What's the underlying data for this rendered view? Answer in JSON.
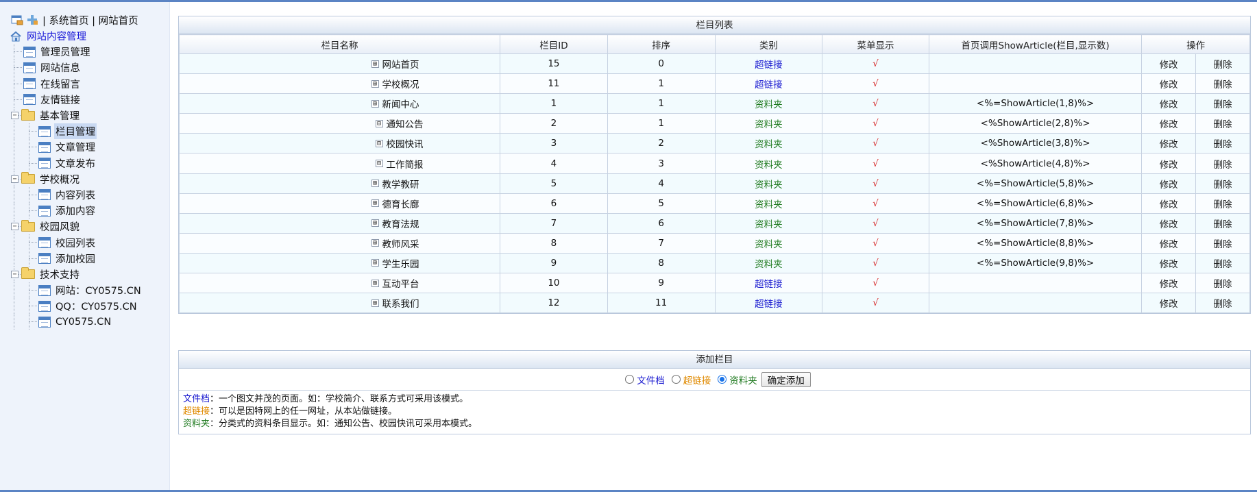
{
  "sidebar": {
    "top_links": "| 系统首页 | 网站首页",
    "root": "网站内容管理",
    "items": [
      {
        "label": "管理员管理",
        "level": 1,
        "type": "page"
      },
      {
        "label": "网站信息",
        "level": 1,
        "type": "page"
      },
      {
        "label": "在线留言",
        "level": 1,
        "type": "page"
      },
      {
        "label": "友情链接",
        "level": 1,
        "type": "page"
      },
      {
        "label": "基本管理",
        "level": 1,
        "type": "folder"
      },
      {
        "label": "栏目管理",
        "level": 2,
        "type": "page",
        "selected": true
      },
      {
        "label": "文章管理",
        "level": 2,
        "type": "page"
      },
      {
        "label": "文章发布",
        "level": 2,
        "type": "page"
      },
      {
        "label": "学校概况",
        "level": 1,
        "type": "folder"
      },
      {
        "label": "内容列表",
        "level": 2,
        "type": "page"
      },
      {
        "label": "添加内容",
        "level": 2,
        "type": "page"
      },
      {
        "label": "校园风貌",
        "level": 1,
        "type": "folder"
      },
      {
        "label": "校园列表",
        "level": 2,
        "type": "page"
      },
      {
        "label": "添加校园",
        "level": 2,
        "type": "page"
      },
      {
        "label": "技术支持",
        "level": 1,
        "type": "folder"
      },
      {
        "label": "网站：CY0575.CN",
        "level": 2,
        "type": "page"
      },
      {
        "label": "QQ：CY0575.CN",
        "level": 2,
        "type": "page"
      },
      {
        "label": "CY0575.CN",
        "level": 2,
        "type": "page"
      }
    ]
  },
  "list": {
    "title": "栏目列表",
    "headers": [
      "栏目名称",
      "栏目ID",
      "排序",
      "类别",
      "菜单显示",
      "首页调用ShowArticle(栏目,显示数)",
      "操作"
    ],
    "edit_label": "修改",
    "delete_label": "删除",
    "rows": [
      {
        "name": "网站首页",
        "expander": "⊞",
        "indent": 0,
        "id": "15",
        "order": "0",
        "category": "超链接",
        "kind": "hyper",
        "menu": "√",
        "call": ""
      },
      {
        "name": "学校概况",
        "expander": "⊞",
        "indent": 0,
        "id": "11",
        "order": "1",
        "category": "超链接",
        "kind": "hyper",
        "menu": "√",
        "call": ""
      },
      {
        "name": "新闻中心",
        "expander": "⊞",
        "indent": 0,
        "id": "1",
        "order": "1",
        "category": "资料夹",
        "kind": "folder",
        "menu": "√",
        "call": "<%=ShowArticle(1,8)%>"
      },
      {
        "name": "通知公告",
        "expander": "⊟",
        "indent": 1,
        "id": "2",
        "order": "1",
        "category": "资料夹",
        "kind": "folder",
        "menu": "√",
        "call": "<%ShowArticle(2,8)%>"
      },
      {
        "name": "校园快讯",
        "expander": "⊟",
        "indent": 1,
        "id": "3",
        "order": "2",
        "category": "资料夹",
        "kind": "folder",
        "menu": "√",
        "call": "<%ShowArticle(3,8)%>"
      },
      {
        "name": "工作简报",
        "expander": "⊟",
        "indent": 1,
        "id": "4",
        "order": "3",
        "category": "资料夹",
        "kind": "folder",
        "menu": "√",
        "call": "<%ShowArticle(4,8)%>"
      },
      {
        "name": "教学教研",
        "expander": "⊞",
        "indent": 0,
        "id": "5",
        "order": "4",
        "category": "资料夹",
        "kind": "folder",
        "menu": "√",
        "call": "<%=ShowArticle(5,8)%>"
      },
      {
        "name": "德育长廊",
        "expander": "⊞",
        "indent": 0,
        "id": "6",
        "order": "5",
        "category": "资料夹",
        "kind": "folder",
        "menu": "√",
        "call": "<%=ShowArticle(6,8)%>"
      },
      {
        "name": "教育法规",
        "expander": "⊞",
        "indent": 0,
        "id": "7",
        "order": "6",
        "category": "资料夹",
        "kind": "folder",
        "menu": "√",
        "call": "<%=ShowArticle(7,8)%>"
      },
      {
        "name": "教师风采",
        "expander": "⊞",
        "indent": 0,
        "id": "8",
        "order": "7",
        "category": "资料夹",
        "kind": "folder",
        "menu": "√",
        "call": "<%=ShowArticle(8,8)%>"
      },
      {
        "name": "学生乐园",
        "expander": "⊞",
        "indent": 0,
        "id": "9",
        "order": "8",
        "category": "资料夹",
        "kind": "folder",
        "menu": "√",
        "call": "<%=ShowArticle(9,8)%>"
      },
      {
        "name": "互动平台",
        "expander": "⊞",
        "indent": 0,
        "id": "10",
        "order": "9",
        "category": "超链接",
        "kind": "hyper",
        "menu": "√",
        "call": ""
      },
      {
        "name": "联系我们",
        "expander": "⊞",
        "indent": 0,
        "id": "12",
        "order": "11",
        "category": "超链接",
        "kind": "hyper",
        "menu": "√",
        "call": ""
      }
    ]
  },
  "add": {
    "title": "添加栏目",
    "options": [
      {
        "label": "文件档",
        "checked": false
      },
      {
        "label": "超链接",
        "checked": false
      },
      {
        "label": "资料夹",
        "checked": true
      }
    ],
    "submit_label": "确定添加",
    "notes": [
      {
        "key": "文件档",
        "text": "：一个图文并茂的页面。如：学校简介、联系方式可采用该模式。"
      },
      {
        "key": "超链接",
        "text": "：可以是因特网上的任一网址，从本站做链接。"
      },
      {
        "key": "资料夹",
        "text": "：分类式的资料条目显示。如：通知公告、校园快讯可采用本模式。"
      }
    ]
  },
  "colors": {
    "hyperlink": "#1a1ad0",
    "folder": "#1f7a1f",
    "tick": "#d42020",
    "link_note": "#e08a00"
  }
}
